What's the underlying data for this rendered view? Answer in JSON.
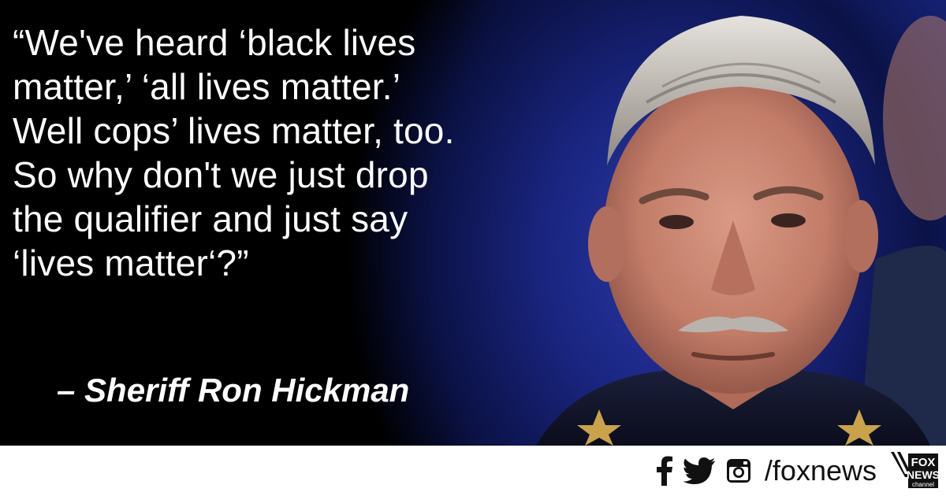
{
  "quote": {
    "lines": [
      "“We've heard ‘black lives",
      "matter,’ ‘all lives matter.’",
      "Well cops’ lives matter, too.",
      "So why don't we just drop",
      "the qualifier and just say",
      "‘lives matter‘?”"
    ],
    "attribution": "– Sheriff Ron Hickman"
  },
  "footer": {
    "icons": [
      "facebook-icon",
      "twitter-icon",
      "instagram-icon"
    ],
    "handle": "/foxnews",
    "logo_text": [
      "FOX",
      "NEWS",
      "channel"
    ]
  },
  "colors": {
    "background": "#000000",
    "accent_blue": "#1b2a93",
    "text": "#ffffff",
    "footer_bg": "#ffffff"
  }
}
